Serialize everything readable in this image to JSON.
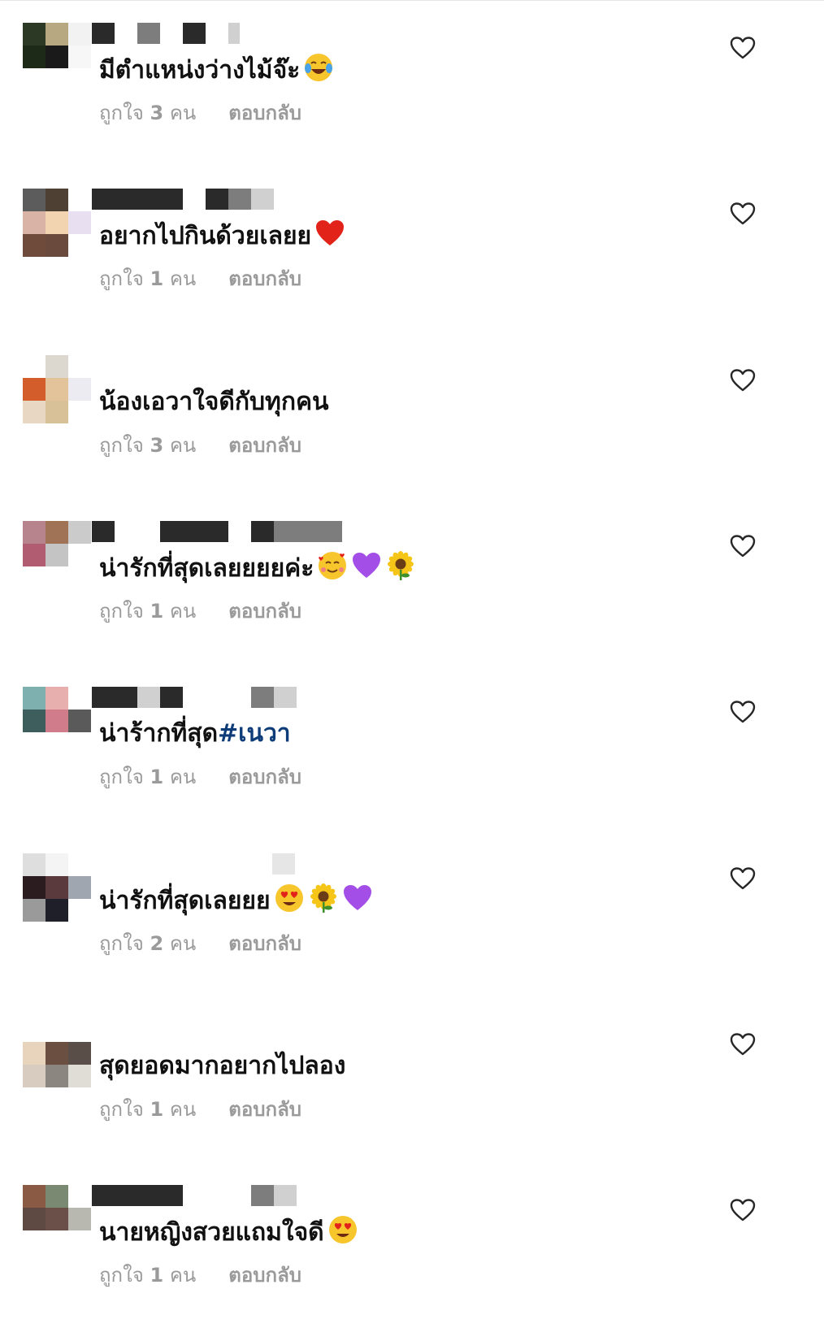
{
  "comments": [
    {
      "text": "มีตำแหน่งว่างไม้จ๊ะ",
      "emojis": [
        "laughing-tears"
      ],
      "likes_prefix": "ถูกใจ",
      "likes_count": "3",
      "likes_suffix": "คน",
      "reply_label": "ตอบกลับ",
      "avatar_colors": [
        "#2c3a25",
        "#b7a882",
        "#f2f2f2",
        "#1d2a18",
        "#1a1a1a",
        "#f7f7f7",
        "#ffffff",
        "#ffffff",
        "#ffffff"
      ],
      "name_blocks": [
        "#2a2a2a",
        "#ffffff",
        "#7d7d7d",
        "#ffffff",
        "#2a2a2a",
        "#ffffff",
        "#d0d0d0"
      ]
    },
    {
      "text": "อยากไปกินด้วยเลยย",
      "emojis": [
        "red-heart"
      ],
      "likes_prefix": "ถูกใจ",
      "likes_count": "1",
      "likes_suffix": "คน",
      "reply_label": "ตอบกลับ",
      "avatar_colors": [
        "#5c5c5c",
        "#4e4033",
        "#ffffff",
        "#d9b4a6",
        "#f2d4b0",
        "#e8e0f0",
        "#6e4b3a",
        "#6a4a3c",
        "#ffffff"
      ],
      "name_blocks": [
        "#2a2a2a",
        "#2a2a2a",
        "#ffffff",
        "#2a2a2a",
        "#7d7d7d",
        "#d0d0d0"
      ]
    },
    {
      "text": "น้องเอวาใจดีกับทุกคน",
      "emojis": [],
      "likes_prefix": "ถูกใจ",
      "likes_count": "3",
      "likes_suffix": "คน",
      "reply_label": "ตอบกลับ",
      "avatar_colors": [
        "#ffffff",
        "#ddd8cf",
        "#ffffff",
        "#d35e2c",
        "#e3c49a",
        "#ecebf2",
        "#e8d7c2",
        "#d8c098",
        "#ffffff"
      ],
      "name_blocks": [
        "#ffffff"
      ]
    },
    {
      "text": "น่ารักที่สุดเลยยยยค่ะ",
      "emojis": [
        "smiling-hearts",
        "purple-heart",
        "sunflower"
      ],
      "likes_prefix": "ถูกใจ",
      "likes_count": "1",
      "likes_suffix": "คน",
      "reply_label": "ตอบกลับ",
      "avatar_colors": [
        "#b7848d",
        "#a07256",
        "#cbcbcb",
        "#b25c72",
        "#c4c4c4",
        "#ffffff",
        "#ffffff",
        "#ffffff",
        "#ffffff"
      ],
      "name_blocks": [
        "#2a2a2a",
        "#ffffff",
        "#2a2a2a",
        "#ffffff",
        "#2a2a2a",
        "#7d7d7d"
      ]
    },
    {
      "text": "น่าร้ากที่สุด",
      "hashtag": "#เนวา",
      "emojis": [],
      "likes_prefix": "ถูกใจ",
      "likes_count": "1",
      "likes_suffix": "คน",
      "reply_label": "ตอบกลับ",
      "avatar_colors": [
        "#7fb0b0",
        "#e7b0ae",
        "#ffffff",
        "#3e5e5e",
        "#d07c8a",
        "#5a5a5a",
        "#ffffff",
        "#ffffff",
        "#ffffff"
      ],
      "name_blocks": [
        "#2a2a2a",
        "#d0d0d0",
        "#2a2a2a",
        "#ffffff",
        "#7d7d7d",
        "#d0d0d0"
      ]
    },
    {
      "text": "น่ารักที่สุดเลยยย",
      "emojis": [
        "heart-eyes",
        "sunflower",
        "purple-heart"
      ],
      "likes_prefix": "ถูกใจ",
      "likes_count": "2",
      "likes_suffix": "คน",
      "reply_label": "ตอบกลับ",
      "avatar_colors": [
        "#dedede",
        "#f4f4f4",
        "#ffffff",
        "#2b1d1f",
        "#5a3a3d",
        "#9fa6b0",
        "#9a9a9a",
        "#1f1f2a",
        "#ffffff"
      ],
      "name_blocks": [
        "#ffffff",
        "#e6e6e6"
      ]
    },
    {
      "text": "สุดยอดมากอยากไปลอง",
      "emojis": [],
      "likes_prefix": "ถูกใจ",
      "likes_count": "1",
      "likes_suffix": "คน",
      "reply_label": "ตอบกลับ",
      "avatar_colors": [
        "#ffffff",
        "#ffffff",
        "#ffffff",
        "#e8d3bd",
        "#6b5042",
        "#5a4e48",
        "#d8ccc0",
        "#8c8680",
        "#e0dcd6"
      ],
      "name_blocks": [
        "#ffffff"
      ]
    },
    {
      "text": "นายหญิงสวยแถมใจดี",
      "emojis": [
        "heart-eyes"
      ],
      "likes_prefix": "ถูกใจ",
      "likes_count": "1",
      "likes_suffix": "คน",
      "reply_label": "ตอบกลับ",
      "avatar_colors": [
        "#8a5a44",
        "#7a8a72",
        "#ffffff",
        "#5e4a42",
        "#6a5048",
        "#b8b8b0",
        "#ffffff",
        "#ffffff",
        "#ffffff"
      ],
      "name_blocks": [
        "#2a2a2a",
        "#ffffff",
        "#7d7d7d",
        "#d0d0d0"
      ]
    }
  ],
  "colors": {
    "text": "#111111",
    "meta": "#9a9a9a",
    "hashtag": "#0d3c78",
    "heart_outline": "#262626"
  }
}
